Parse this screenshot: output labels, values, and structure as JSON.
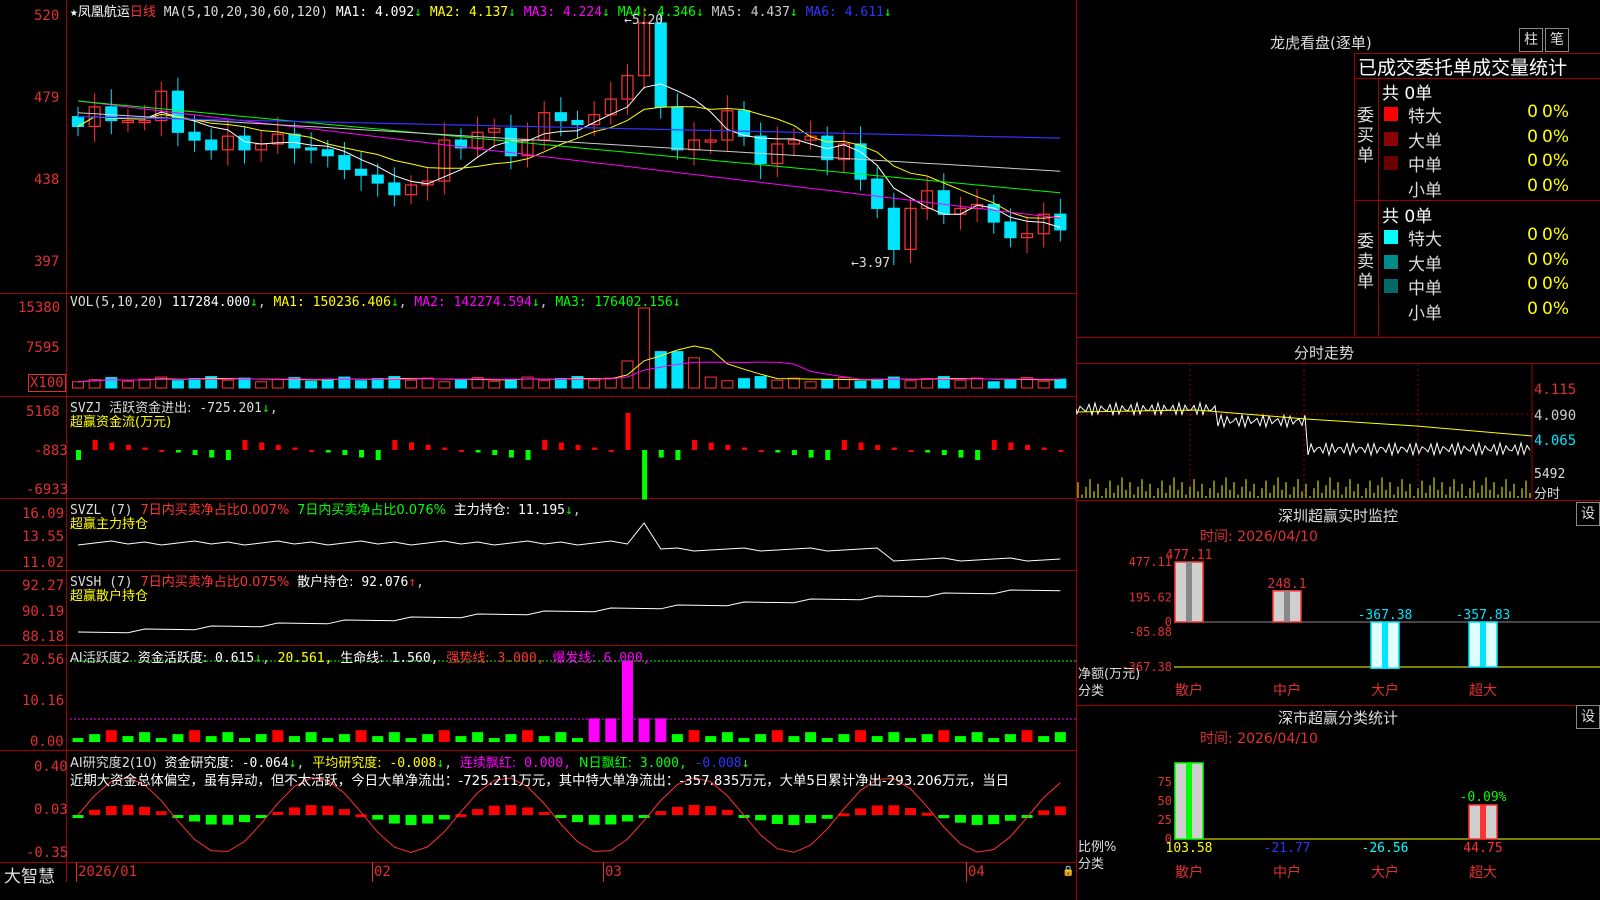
{
  "colors": {
    "up": "#ff3333",
    "down": "#00e5ff",
    "green": "#00ff00",
    "red": "#ff0000",
    "ma1": "#ffffff",
    "ma2": "#ffff00",
    "ma3": "#ff00ff",
    "ma4": "#00ff00",
    "ma5": "#cccccc",
    "ma6": "#3333ff",
    "grid": "#a00000"
  },
  "main": {
    "star": "★",
    "name": "凤凰航运",
    "period": "日线",
    "ma_params": "MA(5,10,20,30,60,120)",
    "ma": [
      {
        "label": "MA1:",
        "value": "4.092"
      },
      {
        "label": "MA2:",
        "value": "4.137"
      },
      {
        "label": "MA3:",
        "value": "4.224"
      },
      {
        "label": "MA4:",
        "value": "4.346"
      },
      {
        "label": "MA5:",
        "value": "4.437"
      },
      {
        "label": "MA6:",
        "value": "4.611"
      }
    ],
    "arrow_down": "↓",
    "high_label": "5.20",
    "low_label": "3.97",
    "prefix_arrow": "←",
    "y_ticks": [
      "520",
      "479",
      "438",
      "397"
    ]
  },
  "vol": {
    "title": "VOL(5,10,20)",
    "value": "117284.000",
    "ma": [
      {
        "label": "MA1:",
        "value": "150236.406"
      },
      {
        "label": "MA2:",
        "value": "142274.594"
      },
      {
        "label": "MA3:",
        "value": "176402.156"
      }
    ],
    "y_ticks": [
      "15380",
      "7595",
      "X100"
    ]
  },
  "svzj": {
    "title": "SVZJ",
    "text": "活跃资金进出:",
    "value": "-725.201",
    "sub": "超赢资金流(万元)",
    "y_ticks": [
      "5168",
      "-883",
      "-6933"
    ]
  },
  "svzl": {
    "title": "SVZL (7)",
    "t1": "7日内买卖净占比0.007%",
    "t2": "7日内买卖净占比0.076%",
    "t3": "主力持仓:",
    "value": "11.195",
    "sub": "超赢主力持仓",
    "y_ticks": [
      "16.09",
      "13.55",
      "11.02"
    ]
  },
  "svsh": {
    "title": "SVSH (7)",
    "t1": "7日内买卖净占比0.075%",
    "t3": "散户持仓:",
    "value": "92.076",
    "sub": "超赢散户持仓",
    "y_ticks": [
      "92.27",
      "90.19",
      "88.18"
    ]
  },
  "ai1": {
    "title": "AI活跃度2",
    "t1": "资金活跃度:",
    "v1": "0.615",
    "v2": "20.561,",
    "t3": "生命线:",
    "v3": "1.560,",
    "t4": "强势线:",
    "v4": "3.000,",
    "t5": "爆发线:",
    "v5": "6.000,",
    "y_ticks": [
      "20.56",
      "10.16",
      "0.00"
    ]
  },
  "ai2": {
    "title": "AI研究度2(10)",
    "t1": "资金研究度:",
    "v1": "-0.064",
    "t2": "平均研究度:",
    "v2": "-0.008",
    "t3": "连续飘红:",
    "v3": "0.000,",
    "t4": "N日飘红:",
    "v4": "3.000,",
    "v5": "-0.008",
    "text": "近期大资金总体偏空，虽有异动，但不太活跃，今日大单净流出：-725.211万元，其中特大单净流出：-357.835万元，大单5日累计净出-293.206万元，当日",
    "y_ticks": [
      "0.40",
      "0.03",
      "-0.35"
    ]
  },
  "xaxis": {
    "brand": "大智慧",
    "labels": [
      "2026/01",
      "02",
      "03",
      "04"
    ]
  },
  "lhb": {
    "title": "龙虎看盘(逐单)",
    "btn1": "柱",
    "btn2": "笔",
    "header": "已成交委托单成交量统计",
    "buy_label": "委买单",
    "sell_label": "委卖单",
    "total_buy": "共 0单",
    "total_sell": "共 0单",
    "buy_rows": [
      {
        "label": "特大",
        "value": "0",
        "pct": "0%",
        "color": "#ff0000"
      },
      {
        "label": "大单",
        "value": "0",
        "pct": "0%",
        "color": "#8b0000"
      },
      {
        "label": "中单",
        "value": "0",
        "pct": "0%",
        "color": "#6a0000"
      },
      {
        "label": "小单",
        "value": "0",
        "pct": "0%",
        "color": ""
      }
    ],
    "sell_rows": [
      {
        "label": "特大",
        "value": "0",
        "pct": "0%",
        "color": "#00ffff"
      },
      {
        "label": "大单",
        "value": "0",
        "pct": "0%",
        "color": "#008b8b"
      },
      {
        "label": "中单",
        "value": "0",
        "pct": "0%",
        "color": "#006a6a"
      },
      {
        "label": "小单",
        "value": "0",
        "pct": "0%",
        "color": ""
      }
    ]
  },
  "fenshi": {
    "title": "分时走势",
    "y_ticks": [
      "4.115",
      "4.090",
      "4.065"
    ],
    "vol_label": "5492",
    "vol_unit": "分时"
  },
  "sz_monitor": {
    "title": "深圳超赢实时监控",
    "btn": "设",
    "time": "时间: 2026/04/10",
    "y_ticks": [
      "477.11",
      "195.62",
      "0",
      "-85.88",
      "-367.38"
    ],
    "bars": [
      {
        "cat": "散户",
        "value": 477.11,
        "label": "477.11"
      },
      {
        "cat": "中户",
        "value": 248.1,
        "label": "248.1"
      },
      {
        "cat": "大户",
        "value": -367.38,
        "label": "-367.38"
      },
      {
        "cat": "超大",
        "value": -357.83,
        "label": "-357.83"
      }
    ],
    "ylab": "净额(万元)",
    "xlab": "分类"
  },
  "sz_class": {
    "title": "深市超赢分类统计",
    "btn": "设",
    "time": "时间: 2026/04/10",
    "y_ticks": [
      "75",
      "50",
      "25",
      "0"
    ],
    "bars": [
      {
        "cat": "散户",
        "value": 103.58,
        "label": "103.58",
        "color": "#ffff00"
      },
      {
        "cat": "中户",
        "value": -21.77,
        "label": "-21.77",
        "color": "#3333ff"
      },
      {
        "cat": "大户",
        "value": -26.56,
        "label": "-26.56",
        "color": "#00ffff"
      },
      {
        "cat": "超大",
        "value": 44.75,
        "label": "44.75",
        "color": "#ff3333"
      }
    ],
    "extra_label": "-0.09%",
    "ylab": "比例%",
    "xlab": "分类"
  }
}
